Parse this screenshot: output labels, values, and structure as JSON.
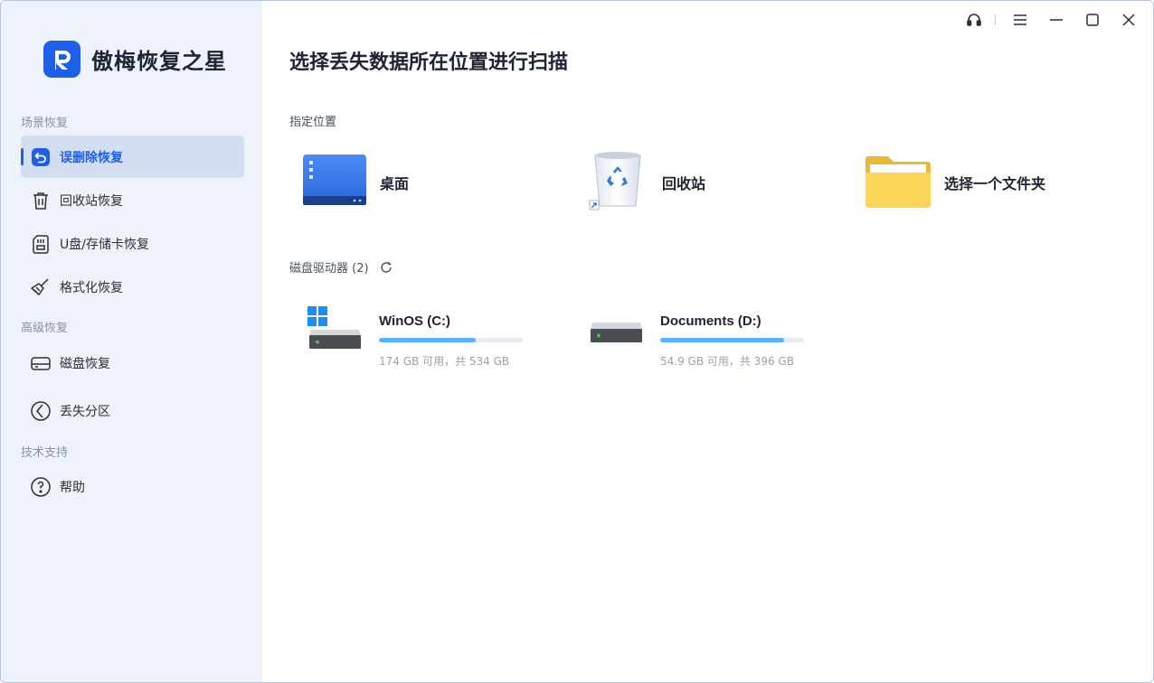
{
  "app": {
    "name": "傲梅恢复之星",
    "accent": "#1f5fe8"
  },
  "titlebar": {
    "icons": [
      "headset-icon",
      "menu-icon",
      "minimize-icon",
      "maximize-icon",
      "close-icon"
    ]
  },
  "sidebar": {
    "sections": [
      {
        "label": "场景恢复"
      },
      {
        "label": "高级恢复"
      },
      {
        "label": "技术支持"
      }
    ],
    "items": [
      {
        "label": "误删除恢复",
        "icon": "undo-icon",
        "active": true
      },
      {
        "label": "回收站恢复",
        "icon": "trash-icon"
      },
      {
        "label": "U盘/存储卡恢复",
        "icon": "sd-card-icon"
      },
      {
        "label": "格式化恢复",
        "icon": "broom-icon"
      },
      {
        "label": "磁盘恢复",
        "icon": "hard-disk-icon"
      },
      {
        "label": "丢失分区",
        "icon": "partition-icon"
      },
      {
        "label": "帮助",
        "icon": "help-icon"
      }
    ]
  },
  "main": {
    "title": "选择丢失数据所在位置进行扫描",
    "locations_heading": "指定位置",
    "locations": [
      {
        "label": "桌面",
        "icon": "desktop-icon"
      },
      {
        "label": "回收站",
        "icon": "recycle-bin-icon"
      },
      {
        "label": "选择一个文件夹",
        "icon": "folder-icon"
      }
    ],
    "drives_heading": "磁盘驱动器 (2)",
    "drives": [
      {
        "name": "WinOS (C:)",
        "info": "174 GB 可用，共 534 GB",
        "used_fraction": 0.674,
        "system": true
      },
      {
        "name": "Documents (D:)",
        "info": "54.9 GB 可用，共 396 GB",
        "used_fraction": 0.861,
        "system": false
      }
    ]
  }
}
